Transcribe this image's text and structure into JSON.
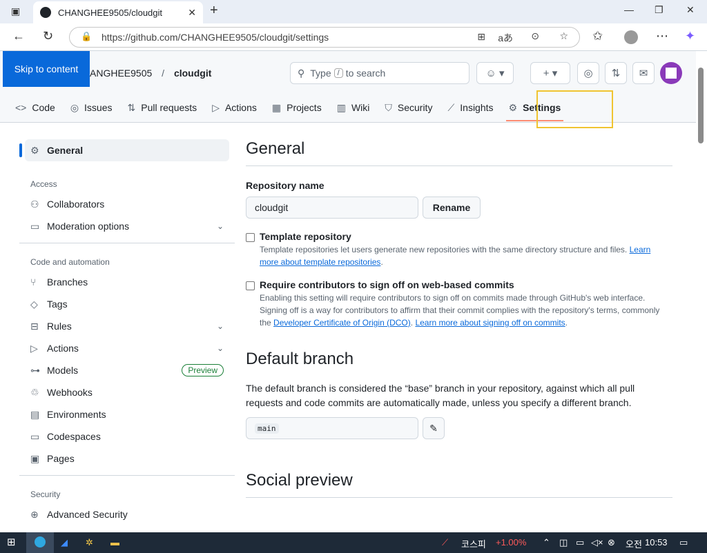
{
  "browser": {
    "tab_title": "CHANGHEE9505/cloudgit",
    "tab_close": "✕",
    "new_tab": "+",
    "url": "https://github.com/CHANGHEE9505/cloudgit/settings"
  },
  "header": {
    "skip_link": "Skip to content",
    "owner": "ANGHEE9505",
    "separator": "/",
    "repo": "cloudgit",
    "search_prefix": "Type",
    "search_key": "/",
    "search_suffix": "to search"
  },
  "repo_nav": [
    {
      "icon": "code-icon",
      "glyph": "<>",
      "label": "Code"
    },
    {
      "icon": "issues-icon",
      "glyph": "◎",
      "label": "Issues"
    },
    {
      "icon": "pull-request-icon",
      "glyph": "⇅",
      "label": "Pull requests"
    },
    {
      "icon": "actions-icon",
      "glyph": "▷",
      "label": "Actions"
    },
    {
      "icon": "projects-icon",
      "glyph": "▦",
      "label": "Projects"
    },
    {
      "icon": "wiki-icon",
      "glyph": "▥",
      "label": "Wiki"
    },
    {
      "icon": "security-icon",
      "glyph": "⛉",
      "label": "Security"
    },
    {
      "icon": "insights-icon",
      "glyph": "⟋",
      "label": "Insights"
    },
    {
      "icon": "settings-icon",
      "glyph": "⚙",
      "label": "Settings"
    }
  ],
  "sidebar": {
    "general": "General",
    "access_heading": "Access",
    "access_items": [
      "Collaborators",
      "Moderation options"
    ],
    "code_heading": "Code and automation",
    "code_items": [
      "Branches",
      "Tags",
      "Rules",
      "Actions",
      "Models",
      "Webhooks",
      "Environments",
      "Codespaces",
      "Pages"
    ],
    "models_badge": "Preview",
    "security_heading": "Security",
    "security_items": [
      "Advanced Security"
    ]
  },
  "main": {
    "general_title": "General",
    "repo_name_label": "Repository name",
    "repo_name_value": "cloudgit",
    "rename_button": "Rename",
    "template_label": "Template repository",
    "template_desc": "Template repositories let users generate new repositories with the same directory structure and files.",
    "template_link": "Learn more about template repositories",
    "signoff_label": "Require contributors to sign off on web-based commits",
    "signoff_desc": "Enabling this setting will require contributors to sign off on commits made through GitHub's web interface. Signing off is a way for contributors to affirm that their commit complies with the repository's terms, commonly the",
    "signoff_link1": "Developer Certificate of Origin (DCO)",
    "signoff_link2": "Learn more about signing off on commits",
    "default_branch_title": "Default branch",
    "default_branch_desc": "The default branch is considered the “base” branch in your repository, against which all pull requests and code commits are automatically made, unless you specify a different branch.",
    "default_branch_value": "main",
    "social_preview_title": "Social preview"
  },
  "taskbar": {
    "stock_name": "코스피",
    "stock_change": "+1.00%",
    "ampm": "오전",
    "time": "10:53"
  },
  "colors": {
    "accent": "#0969da",
    "highlight_box": "#f0c430",
    "stock_red": "#ff5a5a"
  }
}
